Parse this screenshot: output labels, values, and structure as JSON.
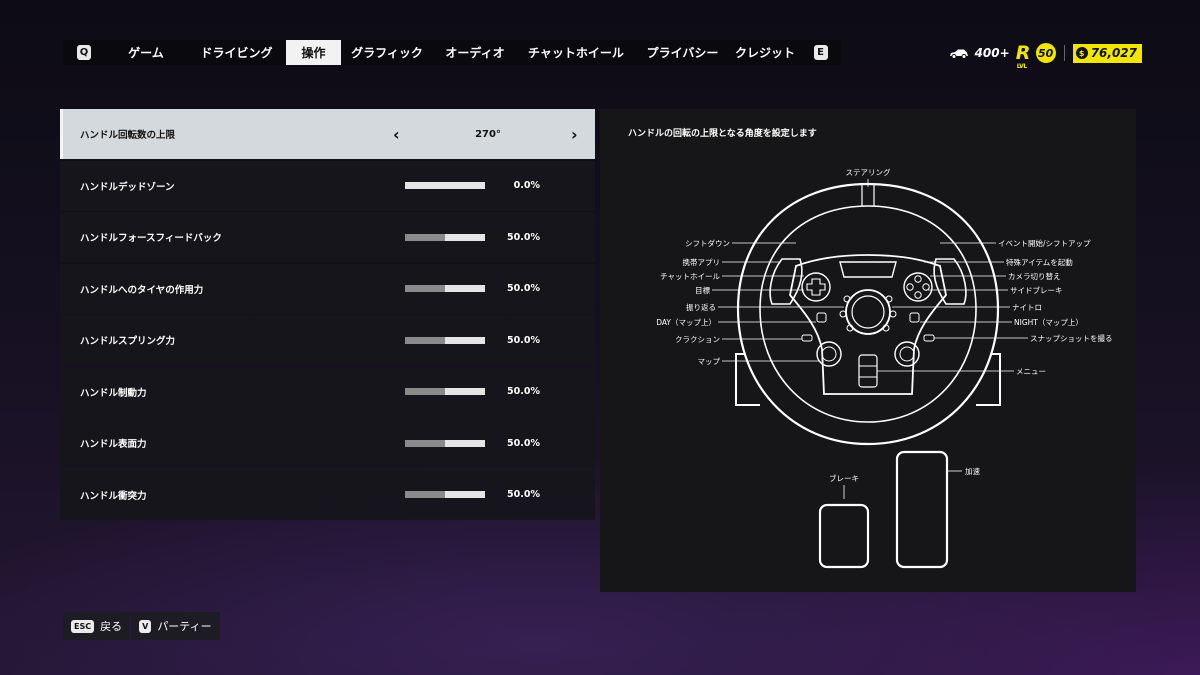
{
  "nav": {
    "left_key": "Q",
    "right_key": "E",
    "tabs": [
      {
        "label": "ゲーム"
      },
      {
        "label": "ドライビング"
      },
      {
        "label": "操作",
        "active": true
      },
      {
        "label": "グラフィック"
      },
      {
        "label": "オーディオ"
      },
      {
        "label": "チャットホイール"
      },
      {
        "label": "プライバシー"
      },
      {
        "label": "クレジット"
      }
    ]
  },
  "status": {
    "performance": "400+",
    "level_badge": "R",
    "level_caption": "LVL",
    "level": "50",
    "currency": "76,027",
    "currency_icon": "$",
    "accent_color": "#f2e600"
  },
  "settings": {
    "selected": {
      "label": "ハンドル回転数の上限",
      "value": "270°"
    },
    "rows": [
      {
        "label": "ハンドルデッドゾーン",
        "value": "0.0%",
        "level": 0.0
      },
      {
        "label": "ハンドルフォースフィードバック",
        "value": "50.0%",
        "level": 0.5
      },
      {
        "label": "ハンドルへのタイヤの作用力",
        "value": "50.0%",
        "level": 0.5
      },
      {
        "label": "ハンドルスプリング力",
        "value": "50.0%",
        "level": 0.5
      },
      {
        "label": "ハンドル制動力",
        "value": "50.0%",
        "level": 0.5
      },
      {
        "label": "ハンドル表面力",
        "value": "50.0%",
        "level": 0.5
      },
      {
        "label": "ハンドル衝突力",
        "value": "50.0%",
        "level": 0.5
      }
    ]
  },
  "panel": {
    "description": "ハンドルの回転の上限となる角度を設定します",
    "labels": {
      "steering": "ステアリング",
      "shift_down": "シフトダウン",
      "mobile_app": "携帯アプリ",
      "chat_wheel": "チャットホイール",
      "objective": "目標",
      "look_back": "振り返る",
      "day": "DAY（マップ上）",
      "horn": "クラクション",
      "map": "マップ",
      "event_start": "イベント開始/シフトアップ",
      "special_item": "特殊アイテムを起動",
      "camera": "カメラ切り替え",
      "handbrake": "サイドブレーキ",
      "nitro": "ナイトロ",
      "night": "NIGHT（マップ上）",
      "snapshot": "スナップショットを撮る",
      "menu": "メニュー",
      "brake": "ブレーキ",
      "accelerate": "加速"
    }
  },
  "footer": {
    "back_key": "ESC",
    "back_label": "戻る",
    "party_key": "V",
    "party_label": "パーティー"
  }
}
